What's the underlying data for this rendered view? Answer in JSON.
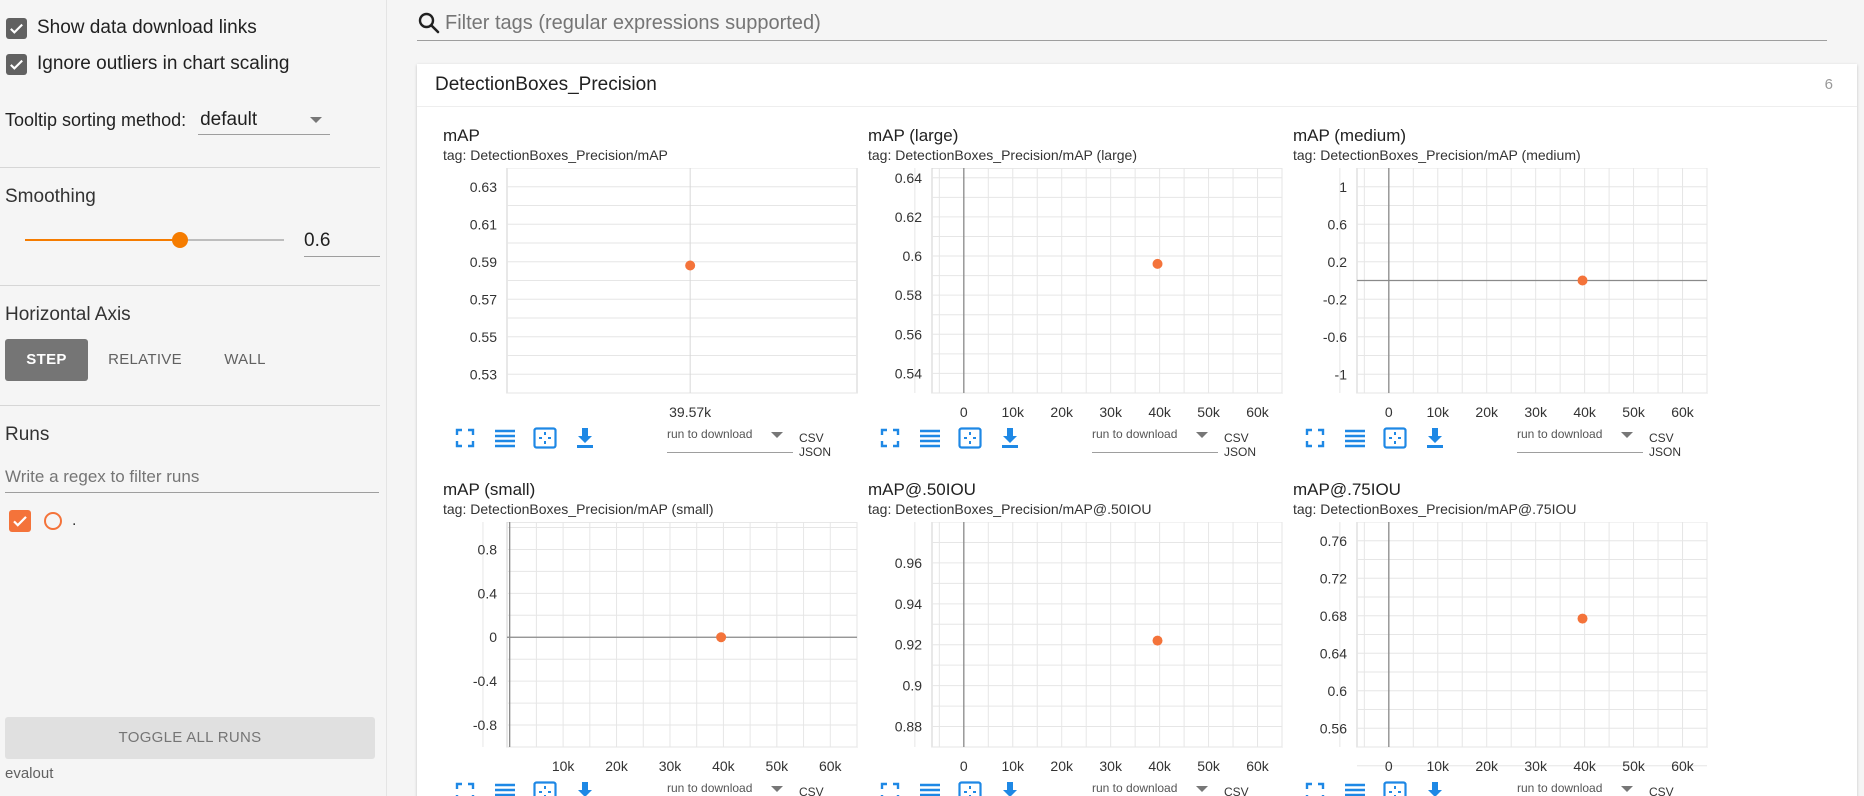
{
  "sidebar": {
    "show_download_links": {
      "label": "Show data download links",
      "checked": true
    },
    "ignore_outliers": {
      "label": "Ignore outliers in chart scaling",
      "checked": true
    },
    "tooltip_sorting": {
      "label": "Tooltip sorting method:",
      "value": "default"
    },
    "smoothing": {
      "label": "Smoothing",
      "value": "0.6",
      "fraction": 0.6
    },
    "horizontal_axis": {
      "label": "Horizontal Axis",
      "options": [
        "STEP",
        "RELATIVE",
        "WALL"
      ],
      "selected": "STEP"
    },
    "runs": {
      "label": "Runs",
      "filter_placeholder": "Write a regex to filter runs",
      "items": [
        {
          "name": ".",
          "checked": true
        }
      ]
    },
    "toggle_all_label": "TOGGLE ALL RUNS",
    "footer_run": "evalout"
  },
  "main": {
    "filter_placeholder": "Filter tags (regular expressions supported)",
    "card": {
      "title": "DetectionBoxes_Precision",
      "count": "6"
    },
    "download": {
      "select_label": "run to download",
      "csv": "CSV",
      "json": "JSON"
    }
  },
  "colors": {
    "accent": "#f57c00",
    "point": "#f4733a",
    "icon_blue": "#1e88e5"
  },
  "chart_data": [
    {
      "type": "scatter",
      "title": "mAP",
      "tag": "tag: DetectionBoxes_Precision/mAP",
      "x": [
        39570
      ],
      "y": [
        0.588
      ],
      "xlim": [
        38000,
        41000
      ],
      "ylim": [
        0.52,
        0.64
      ],
      "xticks": [
        39570
      ],
      "xtick_labels": [
        "39.57k"
      ],
      "yticks": [
        0.53,
        0.55,
        0.57,
        0.59,
        0.61,
        0.63
      ],
      "ytick_labels": [
        "0.53",
        "0.55",
        "0.57",
        "0.59",
        "0.61",
        "0.63"
      ]
    },
    {
      "type": "scatter",
      "title": "mAP (large)",
      "tag": "tag: DetectionBoxes_Precision/mAP (large)",
      "x": [
        39570
      ],
      "y": [
        0.596
      ],
      "xlim": [
        -6500,
        65000
      ],
      "ylim": [
        0.53,
        0.645
      ],
      "xticks": [
        0,
        10000,
        20000,
        30000,
        40000,
        50000,
        60000
      ],
      "xtick_labels": [
        "0",
        "10k",
        "20k",
        "30k",
        "40k",
        "50k",
        "60k"
      ],
      "yticks": [
        0.54,
        0.56,
        0.58,
        0.6,
        0.62,
        0.64
      ],
      "ytick_labels": [
        "0.54",
        "0.56",
        "0.58",
        "0.6",
        "0.62",
        "0.64"
      ]
    },
    {
      "type": "scatter",
      "title": "mAP (medium)",
      "tag": "tag: DetectionBoxes_Precision/mAP (medium)",
      "x": [
        39570
      ],
      "y": [
        0.0
      ],
      "xlim": [
        -6500,
        65000
      ],
      "ylim": [
        -1.2,
        1.2
      ],
      "xticks": [
        0,
        10000,
        20000,
        30000,
        40000,
        50000,
        60000
      ],
      "xtick_labels": [
        "0",
        "10k",
        "20k",
        "30k",
        "40k",
        "50k",
        "60k"
      ],
      "yticks": [
        -1,
        -0.6,
        -0.2,
        0.2,
        0.6,
        1
      ],
      "ytick_labels": [
        "-1",
        "-0.6",
        "-0.2",
        "0.2",
        "0.6",
        "1"
      ]
    },
    {
      "type": "scatter",
      "title": "mAP (small)",
      "tag": "tag: DetectionBoxes_Precision/mAP (small)",
      "x": [
        39570
      ],
      "y": [
        0.0
      ],
      "xlim": [
        -500,
        65000
      ],
      "ylim": [
        -1.0,
        1.05
      ],
      "xticks": [
        10000,
        20000,
        30000,
        40000,
        50000,
        60000
      ],
      "xtick_labels": [
        "10k",
        "20k",
        "30k",
        "40k",
        "50k",
        "60k"
      ],
      "yticks": [
        -0.8,
        -0.4,
        0,
        0.4,
        0.8
      ],
      "ytick_labels": [
        "-0.8",
        "-0.4",
        "0",
        "0.4",
        "0.8"
      ]
    },
    {
      "type": "scatter",
      "title": "mAP@.50IOU",
      "tag": "tag: DetectionBoxes_Precision/mAP@.50IOU",
      "x": [
        39570
      ],
      "y": [
        0.922
      ],
      "xlim": [
        -6500,
        65000
      ],
      "ylim": [
        0.87,
        0.98
      ],
      "xticks": [
        0,
        10000,
        20000,
        30000,
        40000,
        50000,
        60000
      ],
      "xtick_labels": [
        "0",
        "10k",
        "20k",
        "30k",
        "40k",
        "50k",
        "60k"
      ],
      "yticks": [
        0.88,
        0.9,
        0.92,
        0.94,
        0.96
      ],
      "ytick_labels": [
        "0.88",
        "0.9",
        "0.92",
        "0.94",
        "0.96"
      ]
    },
    {
      "type": "scatter",
      "title": "mAP@.75IOU",
      "tag": "tag: DetectionBoxes_Precision/mAP@.75IOU",
      "x": [
        39570
      ],
      "y": [
        0.677
      ],
      "xlim": [
        -6500,
        65000
      ],
      "ylim": [
        0.54,
        0.78
      ],
      "xticks": [
        0,
        10000,
        20000,
        30000,
        40000,
        50000,
        60000
      ],
      "xtick_labels": [
        "0",
        "10k",
        "20k",
        "30k",
        "40k",
        "50k",
        "60k"
      ],
      "yticks": [
        0.56,
        0.6,
        0.64,
        0.68,
        0.72,
        0.76
      ],
      "ytick_labels": [
        "0.56",
        "0.6",
        "0.64",
        "0.68",
        "0.72",
        "0.76"
      ]
    }
  ]
}
